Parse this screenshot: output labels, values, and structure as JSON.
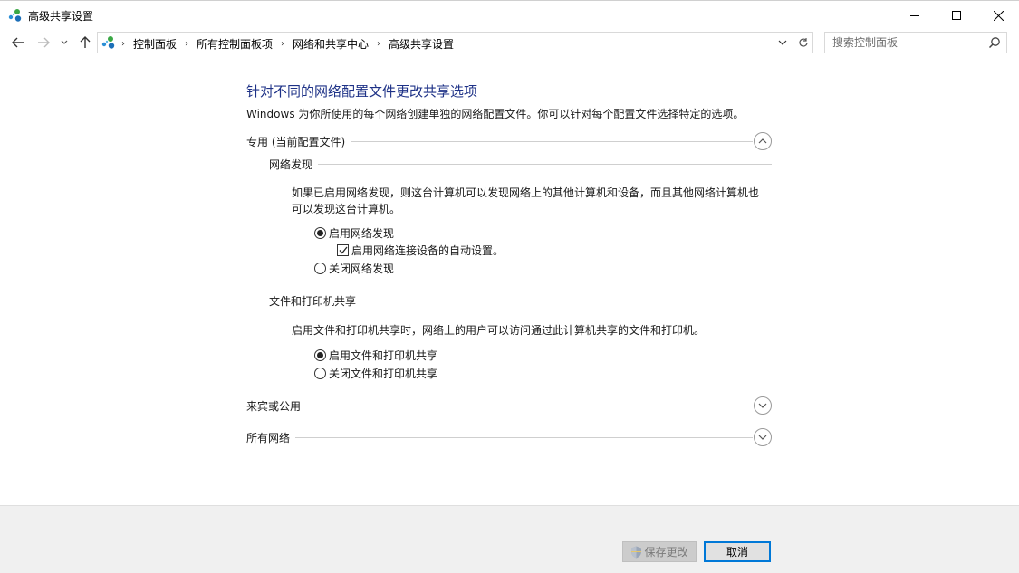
{
  "window": {
    "title": "高级共享设置"
  },
  "address": {
    "breadcrumbs": [
      "控制面板",
      "所有控制面板项",
      "网络和共享中心",
      "高级共享设置"
    ]
  },
  "search": {
    "placeholder": "搜索控制面板"
  },
  "page": {
    "heading": "针对不同的网络配置文件更改共享选项",
    "intro": "Windows 为你所使用的每个网络创建单独的网络配置文件。你可以针对每个配置文件选择特定的选项。"
  },
  "profiles": [
    {
      "label": "专用 (当前配置文件)",
      "expanded": true
    },
    {
      "label": "来宾或公用",
      "expanded": false
    },
    {
      "label": "所有网络",
      "expanded": false
    }
  ],
  "network_discovery": {
    "title": "网络发现",
    "description_line1": "如果已启用网络发现，则这台计算机可以发现网络上的其他计算机和设备，而且其他网络计算机也",
    "description_line2": "可以发现这台计算机。",
    "options": [
      {
        "label": "启用网络发现",
        "selected": true
      },
      {
        "label": "关闭网络发现",
        "selected": false
      }
    ],
    "auto_setup": {
      "label": "启用网络连接设备的自动设置。",
      "checked": true
    }
  },
  "file_printer_sharing": {
    "title": "文件和打印机共享",
    "description": "启用文件和打印机共享时，网络上的用户可以访问通过此计算机共享的文件和打印机。",
    "options": [
      {
        "label": "启用文件和打印机共享",
        "selected": true
      },
      {
        "label": "关闭文件和打印机共享",
        "selected": false
      }
    ]
  },
  "buttons": {
    "save": "保存更改",
    "cancel": "取消"
  },
  "colors": {
    "heading": "#1e3287",
    "focus_border": "#0078d7"
  }
}
